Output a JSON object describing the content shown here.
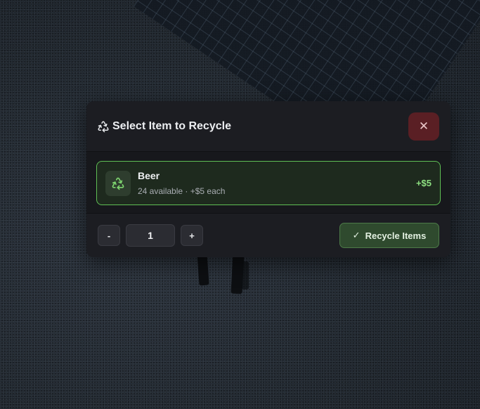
{
  "modal": {
    "title": "Select Item to Recycle",
    "title_icon": "recycle-icon",
    "close_icon": "close-icon",
    "close_symbol": "✕"
  },
  "item": {
    "name": "Beer",
    "subtitle": "24 available · +$5 each",
    "price": "+$5",
    "icon": "recycle-icon",
    "selected": true
  },
  "quantity": {
    "minus_label": "-",
    "value": "1",
    "plus_label": "+"
  },
  "action": {
    "label": "Recycle Items",
    "icon": "check-icon",
    "icon_symbol": "✓"
  },
  "colors": {
    "accent_green": "#5fbf55",
    "price_green": "#8ee081",
    "close_bg": "#5a1f24",
    "panel_bg": "#1c1d22"
  }
}
